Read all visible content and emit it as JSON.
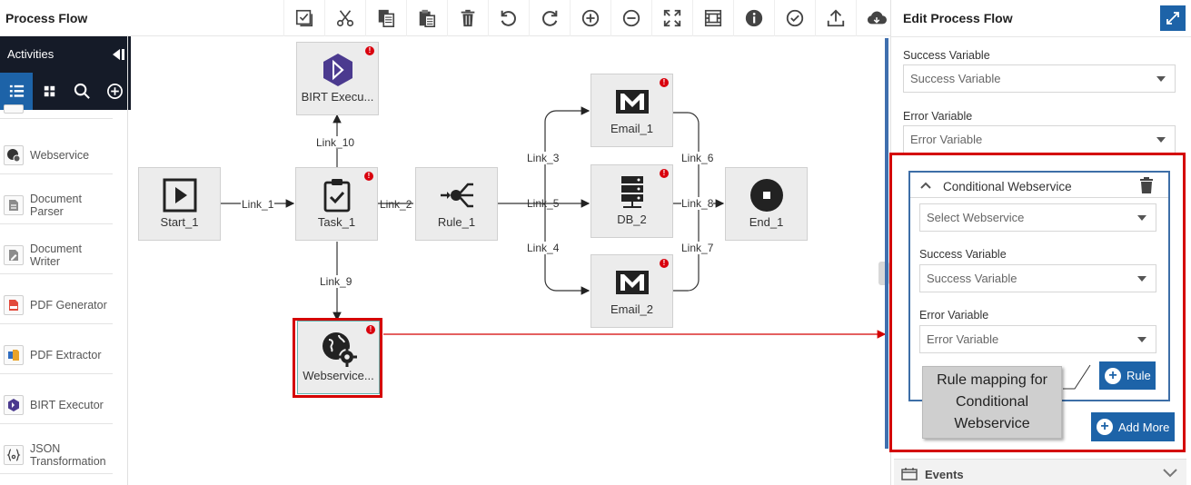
{
  "header": {
    "title": "Process Flow"
  },
  "toolbar": [
    {
      "name": "select-all-icon"
    },
    {
      "name": "cut-icon"
    },
    {
      "name": "copy-icon"
    },
    {
      "name": "paste-icon"
    },
    {
      "name": "delete-icon"
    },
    {
      "name": "undo-icon"
    },
    {
      "name": "redo-icon"
    },
    {
      "name": "zoom-in-icon"
    },
    {
      "name": "zoom-out-icon"
    },
    {
      "name": "fit-screen-icon"
    },
    {
      "name": "grid-icon"
    },
    {
      "name": "info-icon"
    },
    {
      "name": "validate-icon"
    },
    {
      "name": "upload-icon"
    },
    {
      "name": "cloud-icon"
    }
  ],
  "sidebar": {
    "title": "Activities",
    "items": [
      {
        "label": "Webservice"
      },
      {
        "label": "Document\nParser"
      },
      {
        "label": "Document Writer"
      },
      {
        "label": "PDF Generator"
      },
      {
        "label": "PDF Extractor"
      },
      {
        "label": "BIRT Executor"
      },
      {
        "label": "JSON\nTransformation"
      }
    ]
  },
  "canvas": {
    "nodes": {
      "birt": "BIRT Execu...",
      "start": "Start_1",
      "task": "Task_1",
      "rule": "Rule_1",
      "email1": "Email_1",
      "db": "DB_2",
      "email2": "Email_2",
      "end": "End_1",
      "webservice": "Webservice..."
    },
    "links": {
      "l1": "Link_1",
      "l2": "Link_2",
      "l3": "Link_3",
      "l4": "Link_4",
      "l5": "Link_5",
      "l6": "Link_6",
      "l7": "Link_7",
      "l8": "Link_8",
      "l9": "Link_9",
      "l10": "Link_10"
    },
    "error_badge": "!"
  },
  "panel": {
    "title": "Edit Process Flow",
    "success_label": "Success Variable",
    "success_value": "Success Variable",
    "error_label": "Error Variable",
    "error_value": "Error Variable",
    "conditional": {
      "title": "Conditional Webservice",
      "select_value": "Select Webservice",
      "success_label": "Success Variable",
      "success_value": "Success Variable",
      "error_label": "Error Variable",
      "error_value": "Error Variable",
      "rule_button": "Rule"
    },
    "add_more": "Add More",
    "events_label": "Events"
  },
  "callout": {
    "text": "Rule mapping for Conditional Webservice"
  },
  "colors": {
    "accent": "#1d63a8",
    "highlight": "#d40000",
    "dark": "#151b28"
  }
}
